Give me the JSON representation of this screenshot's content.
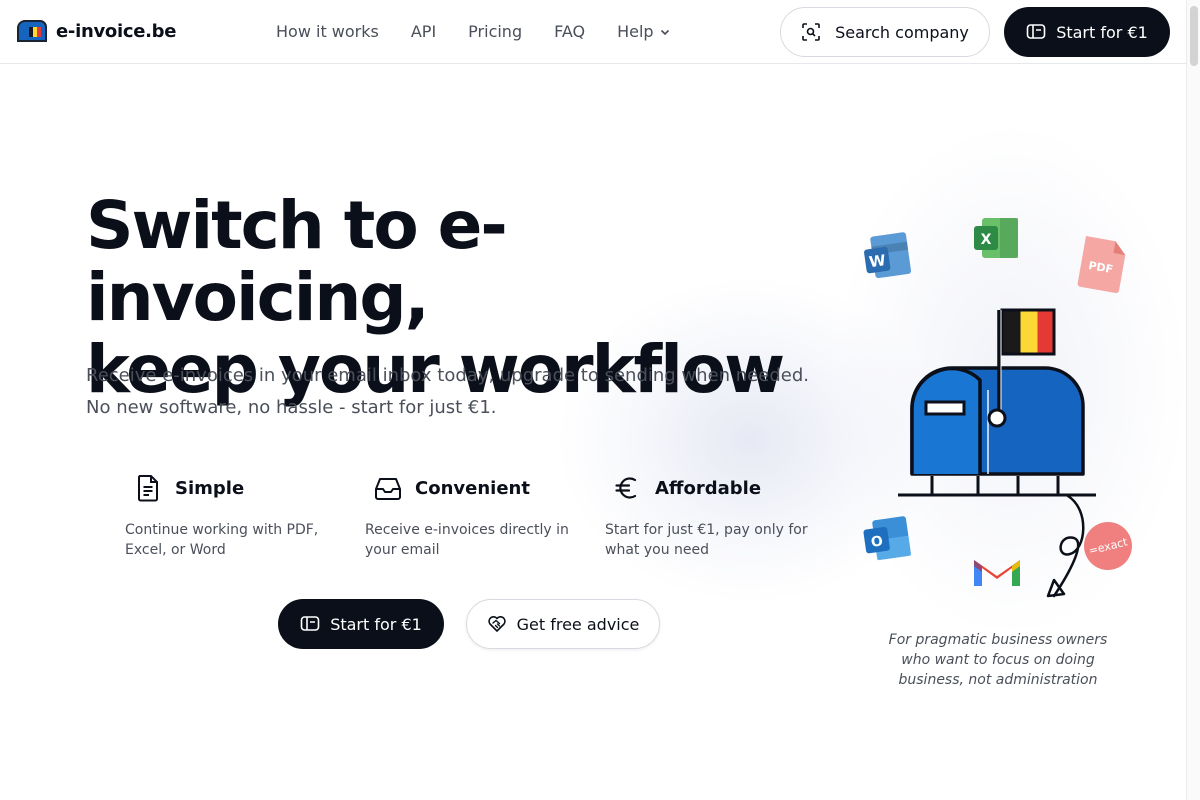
{
  "header": {
    "logo_text": "e-invoice.be",
    "nav": [
      {
        "label": "How it works"
      },
      {
        "label": "API"
      },
      {
        "label": "Pricing"
      },
      {
        "label": "FAQ"
      },
      {
        "label": "Help"
      }
    ],
    "search_label": "Search company",
    "start_label": "Start for €1"
  },
  "hero": {
    "title_line1": "Switch to e-invoicing,",
    "title_line2": "keep your workflow",
    "subtitle": "Receive e-invoices in your email inbox today, upgrade to sending when needed. No new software, no hassle - start for just €1.",
    "features": [
      {
        "title": "Simple",
        "desc": "Continue working with PDF, Excel, or Word",
        "icon": "document-icon"
      },
      {
        "title": "Convenient",
        "desc": "Receive e-invoices directly in your email",
        "icon": "inbox-icon"
      },
      {
        "title": "Affordable",
        "desc": "Start for just €1, pay only for what you need",
        "icon": "euro-icon"
      }
    ],
    "start_label": "Start for €1",
    "advice_label": "Get free advice"
  },
  "illustration": {
    "word_letter": "W",
    "excel_letter": "X",
    "pdf_label": "PDF",
    "outlook_letter": "O",
    "exact_label": "=exact",
    "tagline": "For pragmatic business owners who want to focus on doing business, not administration"
  },
  "colors": {
    "primary_dark": "#0b0f19",
    "mailbox_blue": "#1565c0",
    "flag_black": "#1a1a1a",
    "flag_yellow": "#fdd835",
    "flag_red": "#e53935"
  }
}
